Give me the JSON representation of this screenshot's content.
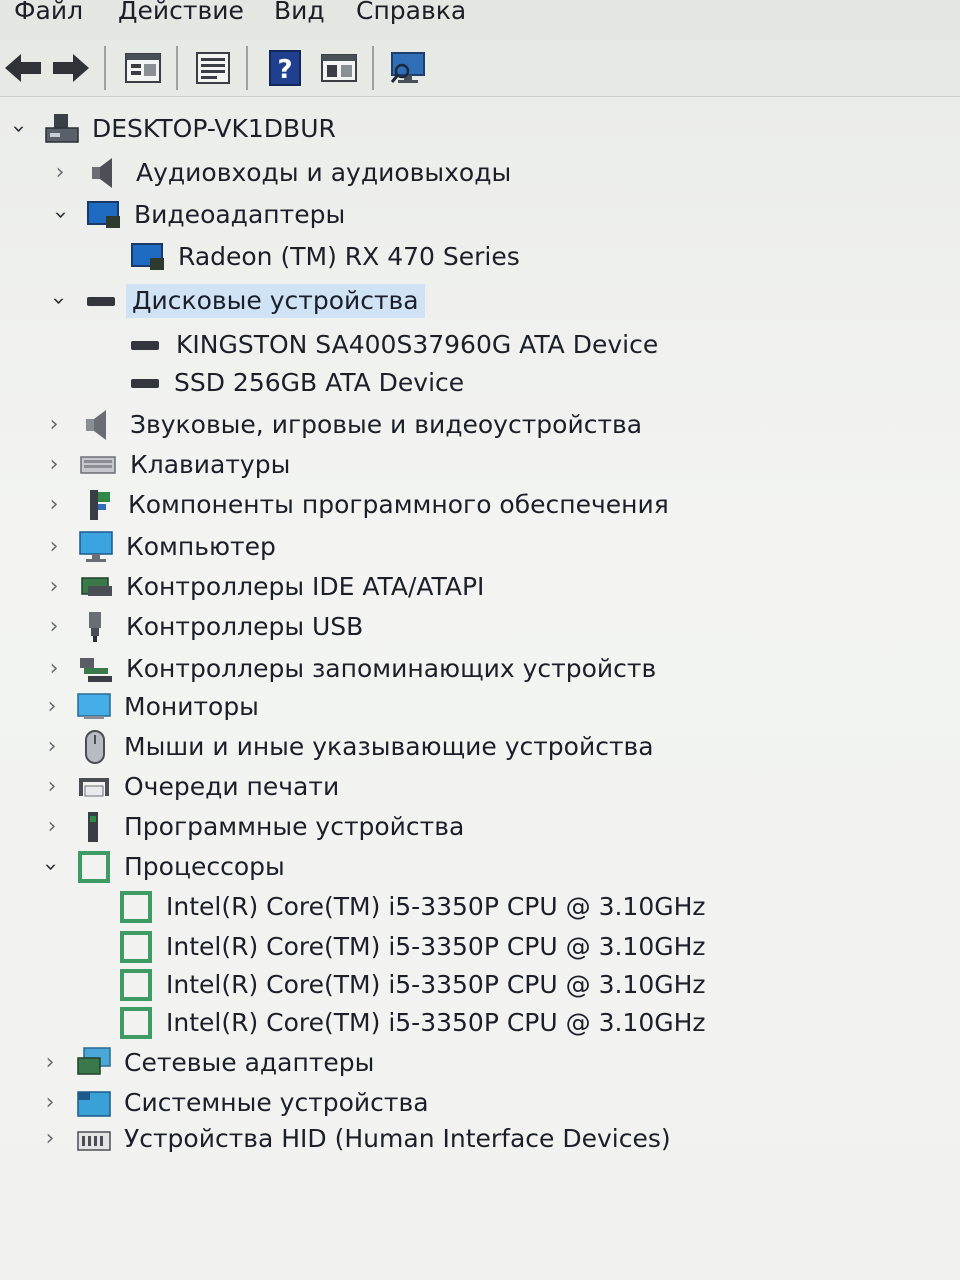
{
  "menu": {
    "file": "Файл",
    "action": "Действие",
    "view": "Вид",
    "help": "Справка"
  },
  "toolbar": {
    "buttons": [
      "back-icon",
      "forward-icon",
      "properties-icon",
      "update-driver-icon",
      "help-icon",
      "view-icon",
      "scan-hardware-icon"
    ]
  },
  "tree": {
    "root": "DESKTOP-VK1DBUR",
    "audio_io": "Аудиовходы и аудиовыходы",
    "video_adapters": "Видеоадаптеры",
    "gpu": "Radeon (TM) RX 470 Series",
    "disk_drives": "Дисковые устройства",
    "disk1": "KINGSTON SA400S37960G ATA Device",
    "disk2": "SSD 256GB ATA Device",
    "sound": "Звуковые, игровые и видеоустройства",
    "keyboards": "Клавиатуры",
    "software_components": "Компоненты программного обеспечения",
    "computer": "Компьютер",
    "ide": "Контроллеры IDE ATA/ATAPI",
    "usb": "Контроллеры USB",
    "storage_ctrl": "Контроллеры запоминающих устройств",
    "monitors": "Мониторы",
    "mice": "Мыши и иные указывающие устройства",
    "print_queues": "Очереди печати",
    "software_devices": "Программные устройства",
    "processors": "Процессоры",
    "cpus": [
      "Intel(R) Core(TM) i5-3350P CPU @ 3.10GHz",
      "Intel(R) Core(TM) i5-3350P CPU @ 3.10GHz",
      "Intel(R) Core(TM) i5-3350P CPU @ 3.10GHz",
      "Intel(R) Core(TM) i5-3350P CPU @ 3.10GHz"
    ],
    "network": "Сетевые адаптеры",
    "system": "Системные устройства",
    "hid": "Устройства HID (Human Interface Devices)"
  },
  "colors": {
    "selection": "#cfe3f5",
    "processor_green": "#3d9b63"
  }
}
